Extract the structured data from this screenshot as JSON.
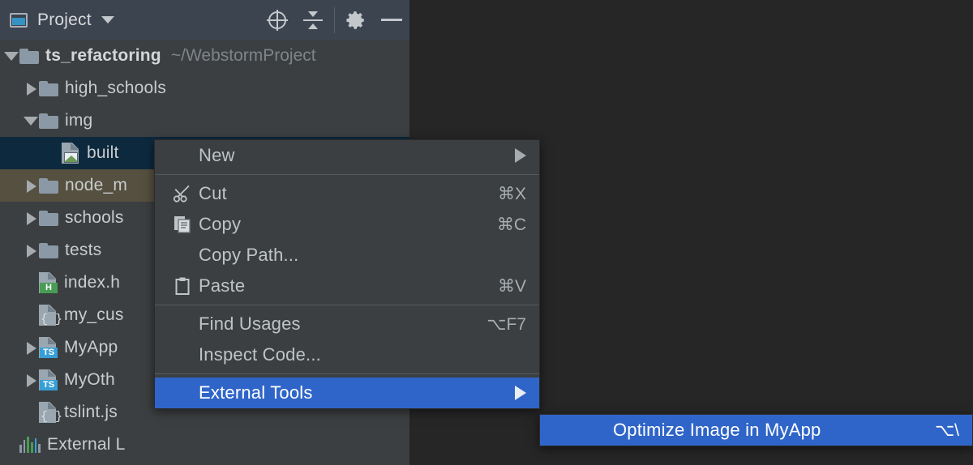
{
  "toolbar": {
    "title": "Project",
    "window_icon": "project-window-icon",
    "dropdown_icon": "chevron-down-icon",
    "actions": [
      {
        "name": "select-opened-file-icon",
        "label": ""
      },
      {
        "name": "collapse-all-icon",
        "label": ""
      },
      {
        "name": "settings-gear-icon",
        "label": ""
      },
      {
        "name": "minimize-icon",
        "label": ""
      }
    ]
  },
  "tree": {
    "rows": [
      {
        "name": "ts_refactoring",
        "path": "~/WebstormProject",
        "kind": "folder",
        "arrow": "open",
        "indent": 0,
        "bold": true,
        "state": "none"
      },
      {
        "name": "high_schools",
        "path": "",
        "kind": "folder",
        "arrow": "closed",
        "indent": 1,
        "bold": false,
        "state": "none"
      },
      {
        "name": "img",
        "path": "",
        "kind": "folder",
        "arrow": "open",
        "indent": 1,
        "bold": false,
        "state": "none"
      },
      {
        "name": "built",
        "path": "",
        "kind": "image",
        "arrow": "none",
        "indent": 2,
        "bold": false,
        "state": "selected"
      },
      {
        "name": "node_m",
        "path": "",
        "kind": "folder",
        "arrow": "closed",
        "indent": 1,
        "bold": false,
        "state": "olive"
      },
      {
        "name": "schools",
        "path": "",
        "kind": "folder",
        "arrow": "closed",
        "indent": 1,
        "bold": false,
        "state": "none"
      },
      {
        "name": "tests",
        "path": "",
        "kind": "folder",
        "arrow": "closed",
        "indent": 1,
        "bold": false,
        "state": "none"
      },
      {
        "name": "index.h",
        "path": "",
        "kind": "html",
        "arrow": "none",
        "indent": 1,
        "bold": false,
        "state": "none"
      },
      {
        "name": "my_cus",
        "path": "",
        "kind": "json",
        "arrow": "none",
        "indent": 1,
        "bold": false,
        "state": "none"
      },
      {
        "name": "MyApp",
        "path": "",
        "kind": "ts",
        "arrow": "closed",
        "indent": 1,
        "bold": false,
        "state": "none"
      },
      {
        "name": "MyOth",
        "path": "",
        "kind": "ts",
        "arrow": "closed",
        "indent": 1,
        "bold": false,
        "state": "none"
      },
      {
        "name": "tslint.js",
        "path": "",
        "kind": "json",
        "arrow": "none",
        "indent": 1,
        "bold": false,
        "state": "none"
      },
      {
        "name": "External L",
        "path": "",
        "kind": "library",
        "arrow": "none",
        "indent": 0,
        "bold": false,
        "state": "none"
      }
    ]
  },
  "context_menu": {
    "items": [
      {
        "type": "item",
        "label": "New",
        "accel": "",
        "icon": "",
        "submenu": true,
        "highlight": false
      },
      {
        "type": "separator"
      },
      {
        "type": "item",
        "label": "Cut",
        "accel": "⌘X",
        "icon": "scissors-icon",
        "submenu": false,
        "highlight": false
      },
      {
        "type": "item",
        "label": "Copy",
        "accel": "⌘C",
        "icon": "copy-icon",
        "submenu": false,
        "highlight": false
      },
      {
        "type": "item",
        "label": "Copy Path...",
        "accel": "",
        "icon": "",
        "submenu": false,
        "highlight": false
      },
      {
        "type": "item",
        "label": "Paste",
        "accel": "⌘V",
        "icon": "paste-icon",
        "submenu": false,
        "highlight": false
      },
      {
        "type": "separator"
      },
      {
        "type": "item",
        "label": "Find Usages",
        "accel": "⌥F7",
        "icon": "",
        "submenu": false,
        "highlight": false
      },
      {
        "type": "item",
        "label": "Inspect Code...",
        "accel": "",
        "icon": "",
        "submenu": false,
        "highlight": false
      },
      {
        "type": "separator"
      },
      {
        "type": "item",
        "label": "External Tools",
        "accel": "",
        "icon": "",
        "submenu": true,
        "highlight": true
      }
    ]
  },
  "submenu": {
    "items": [
      {
        "type": "item",
        "label": "Optimize Image in MyApp",
        "accel": "⌥\\",
        "icon": "",
        "submenu": false,
        "highlight": true
      }
    ]
  },
  "colors": {
    "toolbar_bg": "#3c4450",
    "panel_bg": "#3c3f41",
    "editor_bg": "#262626",
    "selection_blue": "#2f65c8",
    "tree_selected": "#0d293e",
    "tree_olive": "#55503f",
    "accent_cyan": "#389fd6",
    "accent_green": "#499c54"
  }
}
